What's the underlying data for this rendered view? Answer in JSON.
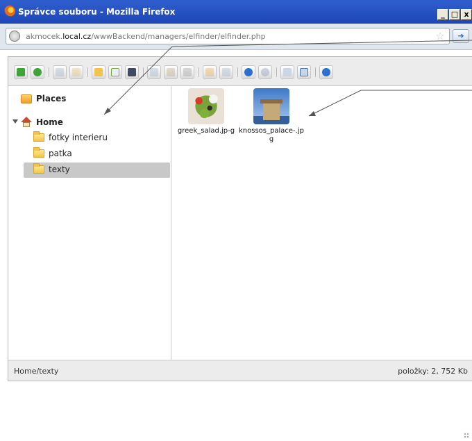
{
  "window": {
    "title": "Správce souboru - Mozilla Firefox",
    "buttons": {
      "minimize": "_",
      "maximize": "□",
      "close": "x"
    }
  },
  "address_bar": {
    "url_prefix": "akmocek.",
    "url_host": "local.cz",
    "url_path": "/wwwBackend/managers/elfinder/elfinder.php"
  },
  "toolbar": {
    "icons": [
      "back-icon",
      "reload-icon",
      "open-icon",
      "edit-folder-icon",
      "new-folder-icon",
      "new-file-icon",
      "upload-icon",
      "copy-icon",
      "paste-icon",
      "cut-icon",
      "rename-icon",
      "edit-icon",
      "info-icon",
      "preview-icon",
      "icons-view-icon",
      "list-view-icon",
      "help-icon"
    ]
  },
  "tree": {
    "places_label": "Places",
    "home_label": "Home",
    "folders": [
      {
        "label": "fotky interieru",
        "selected": false
      },
      {
        "label": "patka",
        "selected": false
      },
      {
        "label": "texty",
        "selected": true
      }
    ]
  },
  "files": [
    {
      "name": "greek_salad.jp-g",
      "thumb": "salad"
    },
    {
      "name": "knossos_palace-.jpg",
      "thumb": "palace"
    }
  ],
  "status": {
    "path": "Home/texty",
    "info": "položky: 2, 752 Kb"
  },
  "colors": {
    "titlebar": "#2f5fcf",
    "selection": "#c8c8c8",
    "toolbar_bg": "#ececec"
  }
}
